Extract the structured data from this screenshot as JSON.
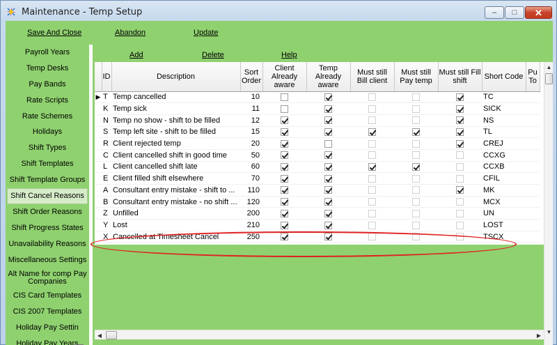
{
  "window": {
    "title": "Maintenance - Temp Setup",
    "minimize": "–",
    "maximize": "□",
    "close": "✕"
  },
  "toolbar": {
    "save_close": "Save And Close",
    "abandon": "Abandon",
    "update": "Update"
  },
  "sidebar": {
    "items": [
      {
        "label": "Payroll Years"
      },
      {
        "label": "Temp Desks"
      },
      {
        "label": "Pay Bands"
      },
      {
        "label": "Rate Scripts"
      },
      {
        "label": "Rate Schemes"
      },
      {
        "label": "Holidays"
      },
      {
        "label": "Shift Types"
      },
      {
        "label": "Shift Templates"
      },
      {
        "label": "Shift Template Groups"
      },
      {
        "label": "Shift Cancel Reasons",
        "selected": true
      },
      {
        "label": "Shift Order Reasons"
      },
      {
        "label": "Shift Progress States"
      },
      {
        "label": "Unavailability Reasons"
      },
      {
        "label": "Miscellaneous Settings"
      },
      {
        "label": "Alt Name for comp Pay Companies",
        "two": true
      },
      {
        "label": "CIS Card Templates"
      },
      {
        "label": "CIS 2007 Templates"
      },
      {
        "label": "Holiday Pay Settin"
      },
      {
        "label": "Holiday Pay Years"
      }
    ]
  },
  "subtoolbar": {
    "add": "Add",
    "delete": "Delete",
    "help": "Help"
  },
  "table": {
    "columns": [
      "ID",
      "Description",
      "Sort Order",
      "Client Already aware",
      "Temp Already aware",
      "Must still Bill client",
      "Must still Pay temp",
      "Must still Fill shift",
      "Short Code",
      "Pu To"
    ],
    "rows": [
      {
        "id": "T",
        "desc": "Temp cancelled",
        "sort": "10",
        "flags": [
          0,
          1,
          0,
          0,
          1
        ],
        "code": "TC",
        "current": true
      },
      {
        "id": "K",
        "desc": "Temp sick",
        "sort": "11",
        "flags": [
          0,
          1,
          0,
          0,
          1
        ],
        "code": "SICK"
      },
      {
        "id": "N",
        "desc": "Temp no show - shift to be filled",
        "sort": "12",
        "flags": [
          1,
          1,
          0,
          0,
          1
        ],
        "code": "NS"
      },
      {
        "id": "S",
        "desc": "Temp left site - shift to be filled",
        "sort": "15",
        "flags": [
          1,
          1,
          1,
          1,
          1
        ],
        "code": "TL"
      },
      {
        "id": "R",
        "desc": "Client rejected temp",
        "sort": "20",
        "flags": [
          1,
          0,
          0,
          0,
          1
        ],
        "code": "CREJ"
      },
      {
        "id": "C",
        "desc": "Client cancelled shift in good time",
        "sort": "50",
        "flags": [
          1,
          1,
          0,
          0,
          0
        ],
        "code": "CCXG"
      },
      {
        "id": "L",
        "desc": "Client cancelled shift late",
        "sort": "60",
        "flags": [
          1,
          1,
          1,
          1,
          0
        ],
        "code": "CCXB"
      },
      {
        "id": "E",
        "desc": "Client filled shift elsewhere",
        "sort": "70",
        "flags": [
          1,
          1,
          0,
          0,
          0
        ],
        "code": "CFIL"
      },
      {
        "id": "A",
        "desc": "Consultant entry mistake - shift to ...",
        "sort": "110",
        "flags": [
          1,
          1,
          0,
          0,
          1
        ],
        "code": "MK"
      },
      {
        "id": "B",
        "desc": "Consultant entry mistake - no shift ...",
        "sort": "120",
        "flags": [
          1,
          1,
          0,
          0,
          0
        ],
        "code": "MCX"
      },
      {
        "id": "Z",
        "desc": "Unfilled",
        "sort": "200",
        "flags": [
          1,
          1,
          0,
          0,
          0
        ],
        "code": "UN"
      },
      {
        "id": "Y",
        "desc": "Lost",
        "sort": "210",
        "flags": [
          1,
          1,
          0,
          0,
          0
        ],
        "code": "LOST"
      },
      {
        "id": "X",
        "desc": "Cancelled at Timesheet Cancel",
        "sort": "250",
        "flags": [
          1,
          1,
          0,
          0,
          0
        ],
        "code": "TSCX"
      }
    ]
  },
  "colors": {
    "panel": "#8fd16f",
    "highlight": "#e02020"
  }
}
